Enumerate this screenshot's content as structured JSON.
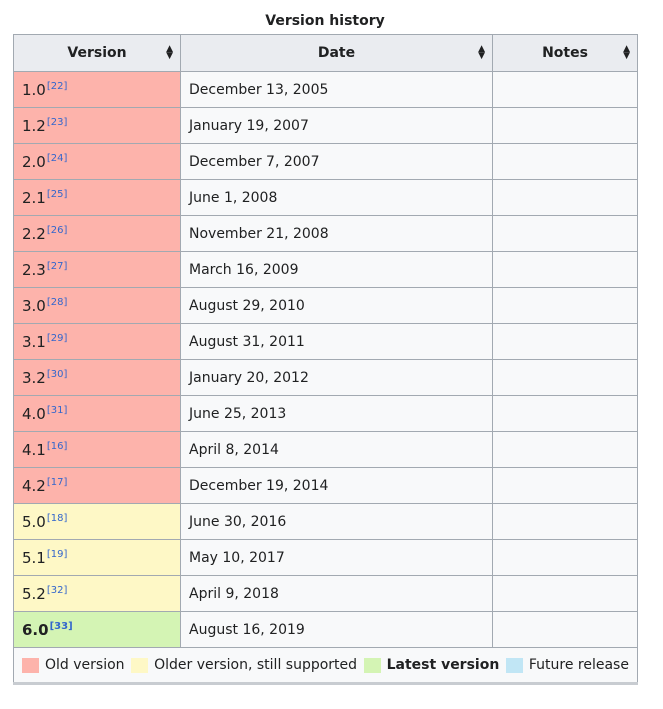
{
  "caption": "Version history",
  "headers": [
    "Version",
    "Date",
    "Notes"
  ],
  "colors": {
    "old": "#fdb3ab",
    "older_supported": "#fef8c6",
    "latest": "#d4f4b4",
    "future": "#c1e6f5",
    "link": "#3366cc"
  },
  "rows": [
    {
      "version": "1.0",
      "ref": "[22]",
      "date": "December 13, 2005",
      "notes": "",
      "status": "old"
    },
    {
      "version": "1.2",
      "ref": "[23]",
      "date": "January 19, 2007",
      "notes": "",
      "status": "old"
    },
    {
      "version": "2.0",
      "ref": "[24]",
      "date": "December 7, 2007",
      "notes": "",
      "status": "old"
    },
    {
      "version": "2.1",
      "ref": "[25]",
      "date": "June 1, 2008",
      "notes": "",
      "status": "old"
    },
    {
      "version": "2.2",
      "ref": "[26]",
      "date": "November 21, 2008",
      "notes": "",
      "status": "old"
    },
    {
      "version": "2.3",
      "ref": "[27]",
      "date": "March 16, 2009",
      "notes": "",
      "status": "old"
    },
    {
      "version": "3.0",
      "ref": "[28]",
      "date": "August 29, 2010",
      "notes": "",
      "status": "old"
    },
    {
      "version": "3.1",
      "ref": "[29]",
      "date": "August 31, 2011",
      "notes": "",
      "status": "old"
    },
    {
      "version": "3.2",
      "ref": "[30]",
      "date": "January 20, 2012",
      "notes": "",
      "status": "old"
    },
    {
      "version": "4.0",
      "ref": "[31]",
      "date": "June 25, 2013",
      "notes": "",
      "status": "old"
    },
    {
      "version": "4.1",
      "ref": "[16]",
      "date": "April 8, 2014",
      "notes": "",
      "status": "old"
    },
    {
      "version": "4.2",
      "ref": "[17]",
      "date": "December 19, 2014",
      "notes": "",
      "status": "old"
    },
    {
      "version": "5.0",
      "ref": "[18]",
      "date": "June 30, 2016",
      "notes": "",
      "status": "older"
    },
    {
      "version": "5.1",
      "ref": "[19]",
      "date": "May 10, 2017",
      "notes": "",
      "status": "older"
    },
    {
      "version": "5.2",
      "ref": "[32]",
      "date": "April 9, 2018",
      "notes": "",
      "status": "older"
    },
    {
      "version": "6.0",
      "ref": "[33]",
      "date": "August 16, 2019",
      "notes": "",
      "status": "latest"
    }
  ],
  "legend": [
    {
      "label": "Old version",
      "key": "old"
    },
    {
      "label": "Older version, still supported",
      "key": "older_supported"
    },
    {
      "label": "Latest version",
      "key": "latest",
      "bold": true
    },
    {
      "label": "Future release",
      "key": "future"
    }
  ]
}
